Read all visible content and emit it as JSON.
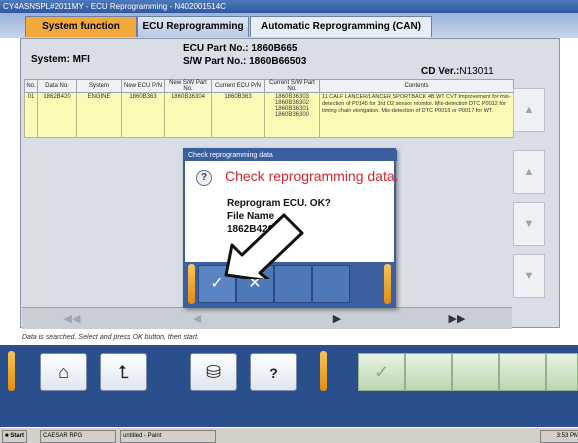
{
  "window": {
    "title": "CY4ASNSPL#2011MY  -  ECU Reprogramming  -  N402001514C"
  },
  "tabs": [
    {
      "label": "System function"
    },
    {
      "label": "ECU Reprogramming"
    },
    {
      "label": "Automatic Reprogramming (CAN)"
    }
  ],
  "header": {
    "system": "System: MFI",
    "ecu_part": "ECU Part No.: 1860B665",
    "sw_part": "S/W Part No.: 1860B66503",
    "cd_ver": "CD Ver.:",
    "cd_ver_value": "N13011"
  },
  "table": {
    "columns": [
      "No.",
      "Data No.",
      "System",
      "New ECU P/N",
      "New S/W Part No.",
      "Current ECU P/N",
      "Current S/W Part No.",
      "Contents"
    ],
    "row": {
      "no": "01",
      "data_no": "1862B420",
      "system": "ENGINE",
      "new_ecu": "1860B363",
      "new_sw": "1860B36304",
      "current_ecu": "1860B363",
      "current_sw": [
        "1860B36303",
        "1860B36302",
        "1860B36301",
        "1860B36300"
      ],
      "contents": "11 CALF LANCER/LANCER SPORTBACK 4B WT CVT   Improvement for mis-detection of P0145 for 3rd O2 sensor monitor. Mis-detection DTC P0012 for timing chain elongation. Mis-detection of DTC P0016 or P0017 for WT."
    }
  },
  "nav": {
    "first": "◀◀",
    "prev": "◀",
    "next": "▶",
    "last": "▶▶"
  },
  "status_line": "Data is searched. Select and press OK button, then start.",
  "dialog": {
    "title": "Check reprogramming data",
    "heading": "Check reprogramming data.",
    "line1": "Reprogram ECU. OK?",
    "line2": "File Name",
    "line3": "1862B420",
    "ok_glyph": "✓",
    "cancel_glyph": "✕"
  },
  "bottom": {
    "home_icon": "home-icon",
    "back_icon": "back-arrow-icon",
    "print_icon": "disk-icon",
    "help_label": "?",
    "confirm_glyph": "✓"
  },
  "taskbar": {
    "start": "Start",
    "item1": "CAESAR RPG",
    "item2": "untitled - Paint",
    "clock": "3:53 PM"
  }
}
